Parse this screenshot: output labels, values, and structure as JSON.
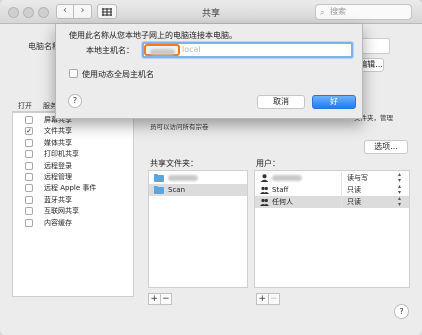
{
  "window": {
    "title": "共享",
    "search_placeholder": "搜索"
  },
  "background": {
    "computer_name_label": "电脑名称",
    "edit_button": "编辑...",
    "services_header": {
      "on": "打开",
      "service": "服务"
    },
    "services": [
      {
        "label": "屏幕共享",
        "checked": false
      },
      {
        "label": "文件共享",
        "checked": true
      },
      {
        "label": "媒体共享",
        "checked": false
      },
      {
        "label": "打印机共享",
        "checked": false
      },
      {
        "label": "远程登录",
        "checked": false
      },
      {
        "label": "远程管理",
        "checked": false
      },
      {
        "label": "远程 Apple 事件",
        "checked": false
      },
      {
        "label": "蓝牙共享",
        "checked": false
      },
      {
        "label": "互联网共享",
        "checked": false
      },
      {
        "label": "内容缓存",
        "checked": false
      }
    ],
    "description": "员可以访问所有宗卷",
    "description_right": "文件夹，管理",
    "options_button": "选项...",
    "shared_folders_label": "共享文件夹：",
    "shared_folders": [
      {
        "label": ""
      },
      {
        "label": "Scan"
      }
    ],
    "users_label": "用户：",
    "users": [
      {
        "name": "",
        "permission": "读与写"
      },
      {
        "name": "Staff",
        "permission": "只读"
      },
      {
        "name": "任何人",
        "permission": "只读"
      }
    ],
    "add_symbol": "+",
    "remove_symbol": "−",
    "help_symbol": "?"
  },
  "sheet": {
    "message": "使用此名称从您本地子网上的电脑连接本电脑。",
    "host_label": "本地主机名：",
    "host_suffix": "local",
    "dynamic_checkbox_label": "使用动态全局主机名",
    "help_symbol": "?",
    "cancel_button": "取消",
    "ok_button": "好"
  },
  "colors": {
    "accent": "#1f7cf2",
    "selection_highlight": "#f07b22",
    "folder": "#5aa6e0"
  },
  "icons": [
    "back-chevron-icon",
    "forward-chevron-icon",
    "grid-icon",
    "search-icon",
    "folder-icon",
    "user-icon",
    "group-icon",
    "stepper-icon"
  ]
}
